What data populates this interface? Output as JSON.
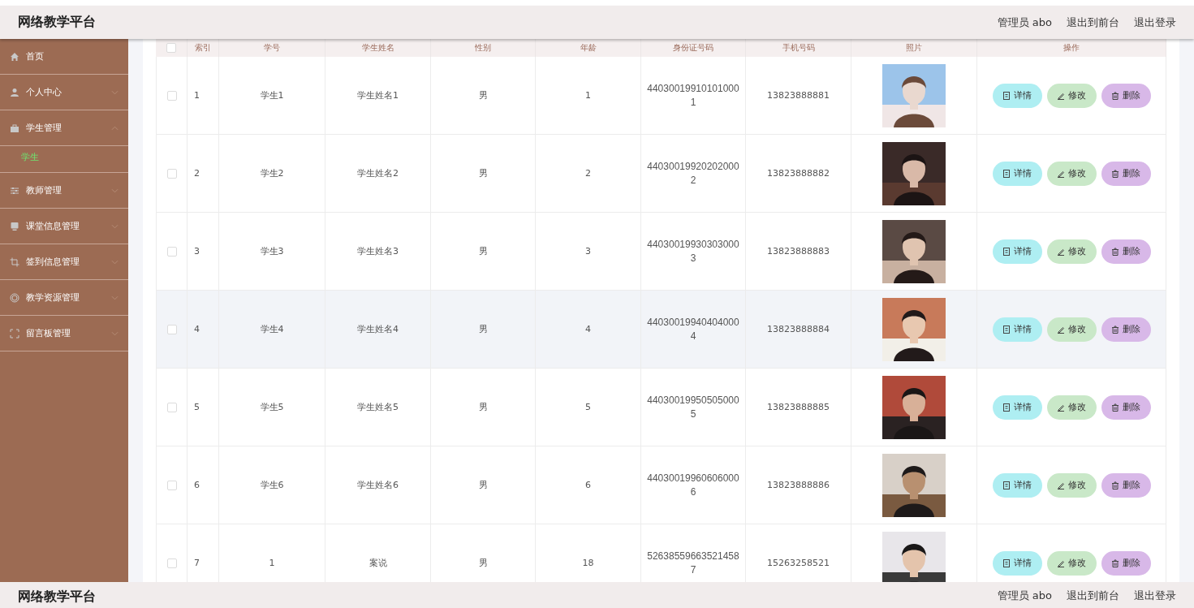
{
  "app_title": "网络教学平台",
  "top_links": [
    "管理员 abo",
    "退出到前台",
    "退出登录"
  ],
  "sidebar": {
    "items": [
      {
        "label": "首页",
        "kind": "link"
      },
      {
        "label": "个人中心",
        "kind": "menu",
        "expanded": false
      },
      {
        "label": "学生管理",
        "kind": "menu",
        "expanded": true,
        "children": [
          {
            "label": "学生",
            "selected": true
          }
        ]
      },
      {
        "label": "教师管理",
        "kind": "menu",
        "expanded": false
      },
      {
        "label": "课堂信息管理",
        "kind": "menu",
        "expanded": false
      },
      {
        "label": "签到信息管理",
        "kind": "menu",
        "expanded": false
      },
      {
        "label": "教学资源管理",
        "kind": "menu",
        "expanded": false
      },
      {
        "label": "留言板管理",
        "kind": "menu",
        "expanded": false
      }
    ]
  },
  "table": {
    "select_all_checked": false,
    "columns": [
      "索引",
      "学号",
      "学生姓名",
      "性别",
      "年龄",
      "身份证号码",
      "手机号码",
      "照片",
      "操作"
    ],
    "rows": [
      {
        "checked": false,
        "highlighted": false,
        "index": "1",
        "student_no": "学生1",
        "name": "学生姓名1",
        "gender": "男",
        "age": "1",
        "id_number": "440300199101010001",
        "phone": "13823888881",
        "actions": [
          "详情",
          "修改",
          "删除"
        ]
      },
      {
        "checked": false,
        "highlighted": false,
        "index": "2",
        "student_no": "学生2",
        "name": "学生姓名2",
        "gender": "男",
        "age": "2",
        "id_number": "440300199202020002",
        "phone": "13823888882",
        "actions": [
          "详情",
          "修改",
          "删除"
        ]
      },
      {
        "checked": false,
        "highlighted": false,
        "index": "3",
        "student_no": "学生3",
        "name": "学生姓名3",
        "gender": "男",
        "age": "3",
        "id_number": "440300199303030003",
        "phone": "13823888883",
        "actions": [
          "详情",
          "修改",
          "删除"
        ]
      },
      {
        "checked": false,
        "highlighted": true,
        "index": "4",
        "student_no": "学生4",
        "name": "学生姓名4",
        "gender": "男",
        "age": "4",
        "id_number": "440300199404040004",
        "phone": "13823888884",
        "actions": [
          "详情",
          "修改",
          "删除"
        ]
      },
      {
        "checked": false,
        "highlighted": false,
        "index": "5",
        "student_no": "学生5",
        "name": "学生姓名5",
        "gender": "男",
        "age": "5",
        "id_number": "440300199505050005",
        "phone": "13823888885",
        "actions": [
          "详情",
          "修改",
          "删除"
        ]
      },
      {
        "checked": false,
        "highlighted": false,
        "index": "6",
        "student_no": "学生6",
        "name": "学生姓名6",
        "gender": "男",
        "age": "6",
        "id_number": "440300199606060006",
        "phone": "13823888886",
        "actions": [
          "详情",
          "修改",
          "删除"
        ]
      },
      {
        "checked": false,
        "highlighted": false,
        "index": "7",
        "student_no": "1",
        "name": "案说",
        "gender": "男",
        "age": "18",
        "id_number": "526385596635214587",
        "phone": "15263258521",
        "actions": [
          "详情",
          "修改",
          "删除"
        ]
      }
    ]
  },
  "bottom_bar": {
    "title": "网络教学平台",
    "links": [
      "管理员 abo",
      "退出到前台",
      "退出登录"
    ]
  }
}
